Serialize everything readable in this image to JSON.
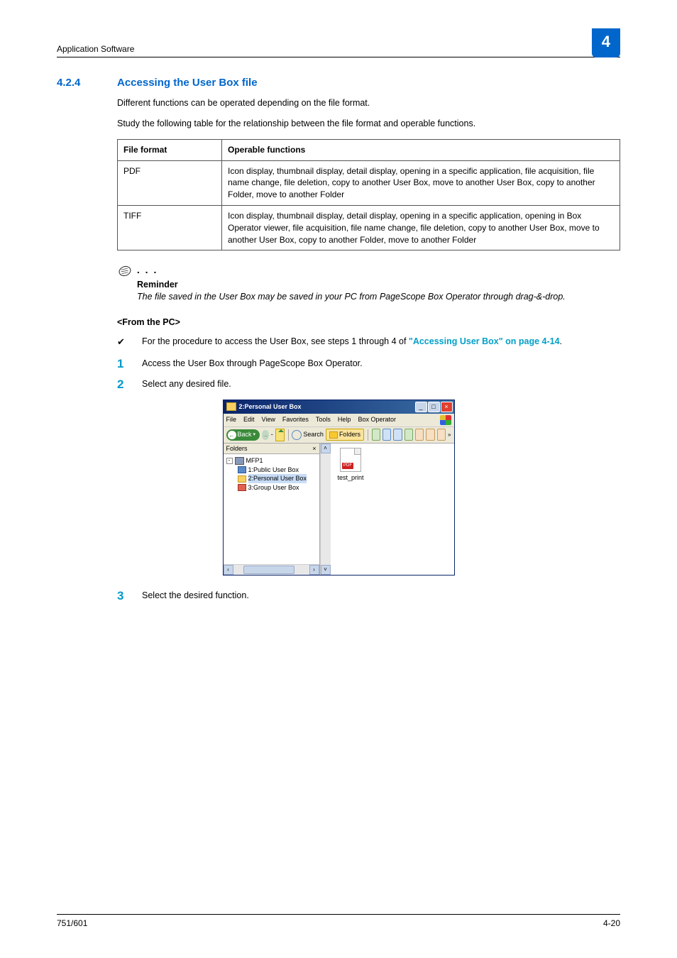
{
  "header": {
    "section_name": "Application Software",
    "chapter_number": "4"
  },
  "heading": {
    "number": "4.2.4",
    "title": "Accessing the User Box file"
  },
  "intro": {
    "p1": "Different functions can be operated depending on the file format.",
    "p2": "Study the following table for the relationship between the file format and operable functions."
  },
  "table": {
    "col1": "File format",
    "col2": "Operable functions",
    "rows": [
      {
        "format": "PDF",
        "funcs": "Icon display, thumbnail display, detail display, opening in a specific application, file acquisition, file name change, file deletion, copy to another User Box, move to another User Box, copy to another Folder, move to another Folder"
      },
      {
        "format": "TIFF",
        "funcs": "Icon display, thumbnail display, detail display, opening in a specific application, opening in Box Operator viewer, file acquisition, file name change, file deletion, copy to another User Box, move to another User Box, copy to another Folder, move to another Folder"
      }
    ]
  },
  "reminder": {
    "label": "Reminder",
    "text": "The file saved in the User Box may be saved in your PC from PageScope Box Operator through drag-&-drop."
  },
  "from_pc": {
    "heading": "<From the PC>",
    "bullet_pre": "For the procedure to access the User Box, see steps 1 through 4 of ",
    "bullet_link": "\"Accessing User Box\" on page 4-14",
    "bullet_post": ".",
    "step1": "Access the User Box through PageScope Box Operator.",
    "step2": "Select any desired file.",
    "step3": "Select the desired function."
  },
  "screenshot": {
    "title": "2:Personal User Box",
    "menu": {
      "file": "File",
      "edit": "Edit",
      "view": "View",
      "favorites": "Favorites",
      "tools": "Tools",
      "help": "Help",
      "boxop": "Box Operator"
    },
    "toolbar": {
      "back": "Back",
      "search": "Search",
      "folders": "Folders"
    },
    "folders_label": "Folders",
    "tree": {
      "root": "MFP1",
      "item1": "1:Public User Box",
      "item2": "2:Personal User Box",
      "item3": "3:Group User Box"
    },
    "file_name": "test_print"
  },
  "footer": {
    "left": "751/601",
    "right": "4-20"
  }
}
